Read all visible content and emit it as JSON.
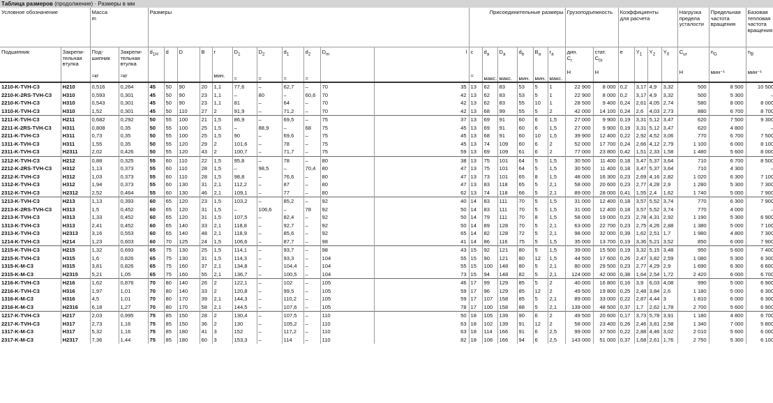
{
  "title": {
    "bold": "Таблица размеров",
    "rest": " (продолжение) · Размеры в мм"
  },
  "headers": {
    "designation": "Условное обозначение",
    "mass": "Масса",
    "mass_sym": "m",
    "dims": "Размеры",
    "conn": "Присоединительные размеры",
    "capacity": "Грузоподъемность",
    "coef": "Коэффициенты",
    "coef2": "для расчета",
    "fatigue1": "Нагрузка",
    "fatigue2": "предела",
    "fatigue3": "усталости",
    "limit1": "Предельная",
    "limit2": "частота",
    "limit3": "вращения",
    "ref1": "Базовая",
    "ref2": "тепловая",
    "ref3": "частота",
    "ref4": "вращения",
    "bearing": "Подшипник",
    "sleeve1": "Закрепи-",
    "sleeve2": "тельная",
    "sleeve3": "втулка",
    "mb1": "Под-",
    "mb2": "шипник",
    "ms1": "Закрепи-",
    "ms2": "тельная",
    "ms3": "втулка",
    "approx_kg": "≈кг",
    "d1H": "d1H",
    "d": "d",
    "D": "D",
    "B": "B",
    "r": "r",
    "r_min": "мин.",
    "D1": "D1",
    "D2": "D2",
    "d1": "d1",
    "d2": "d2",
    "Dm": "Dm",
    "l": "l",
    "c": "c",
    "approx": "≈",
    "da": "da",
    "Da": "Da",
    "db": "db",
    "Ba": "Ba",
    "ra": "ra",
    "maks": "макс.",
    "min": "мин.",
    "dyn": "дин.",
    "Cr": "Cr",
    "stat": "стат.",
    "C0r": "C0r",
    "N": "Н",
    "e": "e",
    "Y1": "Y1",
    "Y2": "Y2",
    "Y0": "Y0",
    "Cur": "Cur",
    "nG": "nG",
    "nB": "nB",
    "rpm": "мин⁻¹"
  },
  "rows": [
    [
      "1210-K-TVH-C3",
      "H210",
      "0,516",
      "0,264",
      "45",
      "50",
      "90",
      "20",
      "1,1",
      "77,6",
      "–",
      "62,7",
      "–",
      "70",
      "35",
      "13",
      "62",
      "83",
      "53",
      "5",
      "1",
      "22 900",
      "8 000",
      "0,2",
      "3,17",
      "4,9",
      "3,32",
      "500",
      "8 500",
      "10 500"
    ],
    [
      "2210-K-2RS-TVH-C3",
      "H310",
      "0,593",
      "0,301",
      "45",
      "50",
      "90",
      "23",
      "1,1",
      "–",
      "80",
      "–",
      "60,6",
      "70",
      "42",
      "13",
      "62",
      "83",
      "53",
      "5",
      "1",
      "22 900",
      "8 000",
      "0,2",
      "3,17",
      "4,9",
      "3,32",
      "500",
      "5 300",
      "–"
    ],
    [
      "2210-K-TVH-C3",
      "H310",
      "0,543",
      "0,301",
      "45",
      "50",
      "90",
      "23",
      "1,1",
      "81",
      "–",
      "64",
      "–",
      "70",
      "42",
      "13",
      "62",
      "83",
      "55",
      "10",
      "1",
      "28 500",
      "9 400",
      "0,24",
      "2,61",
      "4,05",
      "2,74",
      "580",
      "8 000",
      "8 000"
    ],
    [
      "1310-K-TVH-C3",
      "H310",
      "1,52",
      "0,301",
      "45",
      "50",
      "110",
      "27",
      "2",
      "91,9",
      "–",
      "71,2",
      "–",
      "70",
      "42",
      "13",
      "68",
      "99",
      "55",
      "5",
      "2",
      "42 000",
      "14 100",
      "0,24",
      "2,6",
      "4,03",
      "2,73",
      "880",
      "6 700",
      "8 700"
    ],
    [
      "1211-K-TVH-C3",
      "H211",
      "0,682",
      "0,292",
      "50",
      "55",
      "100",
      "21",
      "1,5",
      "86,9",
      "–",
      "69,5",
      "–",
      "75",
      "37",
      "13",
      "69",
      "91",
      "60",
      "6",
      "1,5",
      "27 000",
      "9 900",
      "0,19",
      "3,31",
      "5,12",
      "3,47",
      "620",
      "7 500",
      "9 300"
    ],
    [
      "2211-K-2RS-TVH-C3",
      "H311",
      "0,808",
      "0,35",
      "50",
      "55",
      "100",
      "25",
      "1,5",
      "–",
      "88,9",
      "–",
      "68",
      "75",
      "45",
      "13",
      "69",
      "91",
      "60",
      "6",
      "1,5",
      "27 000",
      "9 900",
      "0,19",
      "3,31",
      "5,12",
      "3,47",
      "620",
      "4 800",
      "–"
    ],
    [
      "2211-K-TVH-C3",
      "H311",
      "0,73",
      "0,35",
      "50",
      "55",
      "100",
      "25",
      "1,5",
      "90",
      "–",
      "69,6",
      "–",
      "75",
      "45",
      "13",
      "68",
      "91",
      "60",
      "10",
      "1,5",
      "39 900",
      "12 400",
      "0,22",
      "2,92",
      "4,52",
      "3,06",
      "770",
      "6 700",
      "7 500"
    ],
    [
      "1311-K-TVH-C3",
      "H311",
      "1,55",
      "0,35",
      "50",
      "55",
      "120",
      "29",
      "2",
      "101,6",
      "–",
      "78",
      "–",
      "75",
      "45",
      "13",
      "74",
      "109",
      "60",
      "6",
      "2",
      "52 000",
      "17 700",
      "0,24",
      "2,66",
      "4,12",
      "2,79",
      "1 100",
      "6 000",
      "8 100"
    ],
    [
      "2311-K-TVH-C3",
      "H2311",
      "2,02",
      "0,426",
      "50",
      "55",
      "120",
      "43",
      "2",
      "100,7",
      "–",
      "71,7",
      "–",
      "75",
      "59",
      "13",
      "69",
      "109",
      "61",
      "6",
      "2",
      "77 000",
      "23 800",
      "0,42",
      "1,51",
      "2,33",
      "1,58",
      "1 480",
      "5 600",
      "8 000"
    ],
    [
      "1212-K-TVH-C3",
      "H212",
      "0,88",
      "0,325",
      "55",
      "60",
      "110",
      "22",
      "1,5",
      "95,8",
      "–",
      "78",
      "–",
      "80",
      "38",
      "13",
      "75",
      "101",
      "64",
      "5",
      "1,5",
      "30 500",
      "11 400",
      "0,18",
      "3,47",
      "5,37",
      "3,64",
      "710",
      "6 700",
      "8 500"
    ],
    [
      "2212-K-2RS-TVH-C3",
      "H312",
      "1,13",
      "0,373",
      "55",
      "60",
      "110",
      "28",
      "1,5",
      "–",
      "98,5",
      "–",
      "70,4",
      "80",
      "47",
      "13",
      "75",
      "101",
      "64",
      "5",
      "1,5",
      "30 500",
      "11 400",
      "0,18",
      "3,47",
      "5,37",
      "3,64",
      "710",
      "4 300",
      "–"
    ],
    [
      "2212-K-TVH-C3",
      "H312",
      "1,03",
      "0,373",
      "55",
      "60",
      "110",
      "28",
      "1,5",
      "98,8",
      "–",
      "76,6",
      "–",
      "80",
      "47",
      "13",
      "73",
      "101",
      "65",
      "8",
      "1,5",
      "48 000",
      "16 300",
      "0,23",
      "2,69",
      "4,16",
      "2,82",
      "1 020",
      "6 300",
      "7 100"
    ],
    [
      "1312-K-TVH-C3",
      "H312",
      "1,94",
      "0,373",
      "55",
      "60",
      "130",
      "31",
      "2,1",
      "112,2",
      "–",
      "87",
      "–",
      "80",
      "47",
      "13",
      "83",
      "118",
      "65",
      "5",
      "2,1",
      "58 000",
      "20 600",
      "0,23",
      "2,77",
      "4,28",
      "2,9",
      "1 280",
      "5 300",
      "7 300"
    ],
    [
      "2312-K-TVH-C3",
      "H2312",
      "2,52",
      "0,464",
      "55",
      "60",
      "130",
      "46",
      "2,1",
      "109,1",
      "–",
      "77",
      "–",
      "80",
      "62",
      "13",
      "74",
      "118",
      "66",
      "5",
      "2,1",
      "89 000",
      "28 000",
      "0,41",
      "1,55",
      "2,4",
      "1,62",
      "1 740",
      "5 000",
      "7 900"
    ],
    [
      "1213-K-TVH-C3",
      "H213",
      "1,13",
      "0,393",
      "60",
      "65",
      "120",
      "23",
      "1,5",
      "103,2",
      "–",
      "85,2",
      "–",
      "92",
      "40",
      "14",
      "83",
      "111",
      "70",
      "5",
      "1,5",
      "31 000",
      "12 400",
      "0,18",
      "3,57",
      "5,52",
      "3,74",
      "770",
      "6 300",
      "7 900"
    ],
    [
      "2213-K-2RS-TVH-C3",
      "H313",
      "1,5",
      "0,452",
      "60",
      "65",
      "120",
      "31",
      "1,5",
      "–",
      "106,6",
      "–",
      "78",
      "92",
      "50",
      "14",
      "83",
      "111",
      "70",
      "5",
      "1,5",
      "31 000",
      "12 400",
      "0,18",
      "3,57",
      "5,52",
      "3,74",
      "770",
      "4 000",
      "–"
    ],
    [
      "2213-K-TVH-C3",
      "H313",
      "1,33",
      "0,452",
      "60",
      "65",
      "120",
      "31",
      "1,5",
      "107,5",
      "–",
      "82,4",
      "–",
      "92",
      "50",
      "14",
      "79",
      "111",
      "70",
      "8",
      "1,5",
      "58 000",
      "19 000",
      "0,23",
      "2,78",
      "4,31",
      "2,92",
      "1 190",
      "5 300",
      "6 900"
    ],
    [
      "1313-K-TVH-C3",
      "H313",
      "2,41",
      "0,452",
      "60",
      "65",
      "140",
      "33",
      "2,1",
      "118,8",
      "–",
      "92,7",
      "–",
      "92",
      "50",
      "14",
      "89",
      "128",
      "70",
      "5",
      "2,1",
      "63 000",
      "22 700",
      "0,23",
      "2,75",
      "4,26",
      "2,88",
      "1 380",
      "5 000",
      "7 100"
    ],
    [
      "2313-K-TVH-C3",
      "H2313",
      "3,16",
      "0,553",
      "60",
      "65",
      "140",
      "48",
      "2,1",
      "118,9",
      "–",
      "85,6",
      "–",
      "92",
      "65",
      "14",
      "82",
      "128",
      "72",
      "5",
      "2,1",
      "98 000",
      "32 000",
      "0,39",
      "1,62",
      "2,51",
      "1,7",
      "1 980",
      "4 800",
      "7 300"
    ],
    [
      "1214-K-TVH-C3",
      "H214",
      "1,23",
      "0,603",
      "60",
      "70",
      "125",
      "24",
      "1,5",
      "106,6",
      "–",
      "87,7",
      "–",
      "98",
      "41",
      "14",
      "86",
      "116",
      "75",
      "5",
      "1,5",
      "35 000",
      "13 700",
      "0,19",
      "3,36",
      "5,21",
      "3,52",
      "850",
      "6 000",
      "7 900"
    ],
    [
      "1215-K-TVH-C3",
      "H215",
      "1,32",
      "0,693",
      "65",
      "75",
      "130",
      "25",
      "1,5",
      "114,1",
      "–",
      "93,7",
      "–",
      "98",
      "43",
      "15",
      "92",
      "121",
      "80",
      "5",
      "1,5",
      "39 000",
      "15 500",
      "0,19",
      "3,32",
      "5,15",
      "3,48",
      "950",
      "5 600",
      "7 400"
    ],
    [
      "2215-K-TVH-C3",
      "H315",
      "1,6",
      "0,826",
      "65",
      "75",
      "130",
      "31",
      "1,5",
      "114,3",
      "–",
      "93,3",
      "–",
      "104",
      "55",
      "15",
      "90",
      "121",
      "80",
      "12",
      "1,5",
      "44 500",
      "17 600",
      "0,26",
      "2,47",
      "3,82",
      "2,59",
      "1 080",
      "5 300",
      "6 300"
    ],
    [
      "1315-K-M-C3",
      "H315",
      "3,81",
      "0,826",
      "65",
      "75",
      "160",
      "37",
      "2,1",
      "134,8",
      "–",
      "104,4",
      "–",
      "104",
      "55",
      "15",
      "100",
      "148",
      "80",
      "5",
      "2,1",
      "80 000",
      "29 500",
      "0,23",
      "2,77",
      "4,29",
      "2,9",
      "1 690",
      "6 300",
      "6 600"
    ],
    [
      "2315-K-M-C3",
      "H2315",
      "5,21",
      "1,05",
      "65",
      "75",
      "160",
      "55",
      "2,1",
      "136,7",
      "–",
      "100,5",
      "–",
      "104",
      "73",
      "15",
      "94",
      "148",
      "82",
      "5",
      "2,1",
      "124 000",
      "42 000",
      "0,38",
      "1,64",
      "2,54",
      "1,72",
      "2 420",
      "6 000",
      "6 700"
    ],
    [
      "1216-K-TVH-C3",
      "H216",
      "1,62",
      "0,876",
      "70",
      "80",
      "140",
      "26",
      "2",
      "122,1",
      "–",
      "102",
      "–",
      "105",
      "46",
      "17",
      "99",
      "129",
      "85",
      "5",
      "2",
      "40 000",
      "16 800",
      "0,16",
      "3,9",
      "6,03",
      "4,08",
      "990",
      "5 000",
      "6 900"
    ],
    [
      "2216-K-TVH-C3",
      "H316",
      "1,97",
      "1,01",
      "70",
      "80",
      "140",
      "33",
      "2",
      "120,8",
      "–",
      "99,5",
      "–",
      "105",
      "59",
      "17",
      "96",
      "129",
      "85",
      "12",
      "2",
      "49 500",
      "19 800",
      "0,25",
      "2,48",
      "3,84",
      "2,6",
      "1 180",
      "5 000",
      "6 300"
    ],
    [
      "1316-K-M-C3",
      "H316",
      "4,5",
      "1,01",
      "70",
      "80",
      "170",
      "39",
      "2,1",
      "144,3",
      "–",
      "110,2",
      "–",
      "105",
      "59",
      "17",
      "107",
      "158",
      "85",
      "5",
      "2,1",
      "89 000",
      "33 000",
      "0,22",
      "2,87",
      "4,44",
      "3",
      "1 810",
      "6 000",
      "6 300"
    ],
    [
      "2316-K-M-C3",
      "H2316",
      "6,18",
      "1,27",
      "70",
      "80",
      "170",
      "58",
      "2,1",
      "144,5",
      "–",
      "107,6",
      "–",
      "105",
      "78",
      "17",
      "100",
      "158",
      "88",
      "5",
      "2,1",
      "139 000",
      "48 500",
      "0,37",
      "1,7",
      "2,62",
      "1,78",
      "2 700",
      "5 600",
      "6 900"
    ],
    [
      "1217-K-TVH-C3",
      "H217",
      "2,03",
      "0,995",
      "75",
      "85",
      "150",
      "28",
      "2",
      "130,4",
      "–",
      "107,5",
      "–",
      "110",
      "50",
      "18",
      "105",
      "139",
      "90",
      "6",
      "2",
      "49 500",
      "20 600",
      "0,17",
      "3,73",
      "5,78",
      "3,91",
      "1 180",
      "4 800",
      "6 700"
    ],
    [
      "2217-K-TVH-C3",
      "H317",
      "2,73",
      "1,16",
      "75",
      "85",
      "150",
      "36",
      "2",
      "130",
      "–",
      "105,2",
      "–",
      "110",
      "63",
      "18",
      "102",
      "139",
      "91",
      "12",
      "2",
      "58 000",
      "23 400",
      "0,26",
      "2,46",
      "3,81",
      "2,58",
      "1 340",
      "7 000",
      "5 800"
    ],
    [
      "1317-K-M-C3",
      "H317",
      "5,32",
      "1,16",
      "75",
      "85",
      "180",
      "41",
      "3",
      "152",
      "–",
      "117,2",
      "–",
      "110",
      "63",
      "18",
      "114",
      "166",
      "91",
      "6",
      "2,5",
      "99 000",
      "37 500",
      "0,22",
      "2,88",
      "4,46",
      "3,02",
      "2 010",
      "5 600",
      "6 000"
    ],
    [
      "2317-K-M-C3",
      "H2317",
      "7,36",
      "1,44",
      "75",
      "85",
      "180",
      "60",
      "3",
      "153,3",
      "–",
      "114",
      "–",
      "110",
      "82",
      "18",
      "106",
      "166",
      "94",
      "6",
      "2,5",
      "143 000",
      "51 000",
      "0,37",
      "1,68",
      "2,61",
      "1,76",
      "2 750",
      "5 300",
      "6 100"
    ]
  ]
}
